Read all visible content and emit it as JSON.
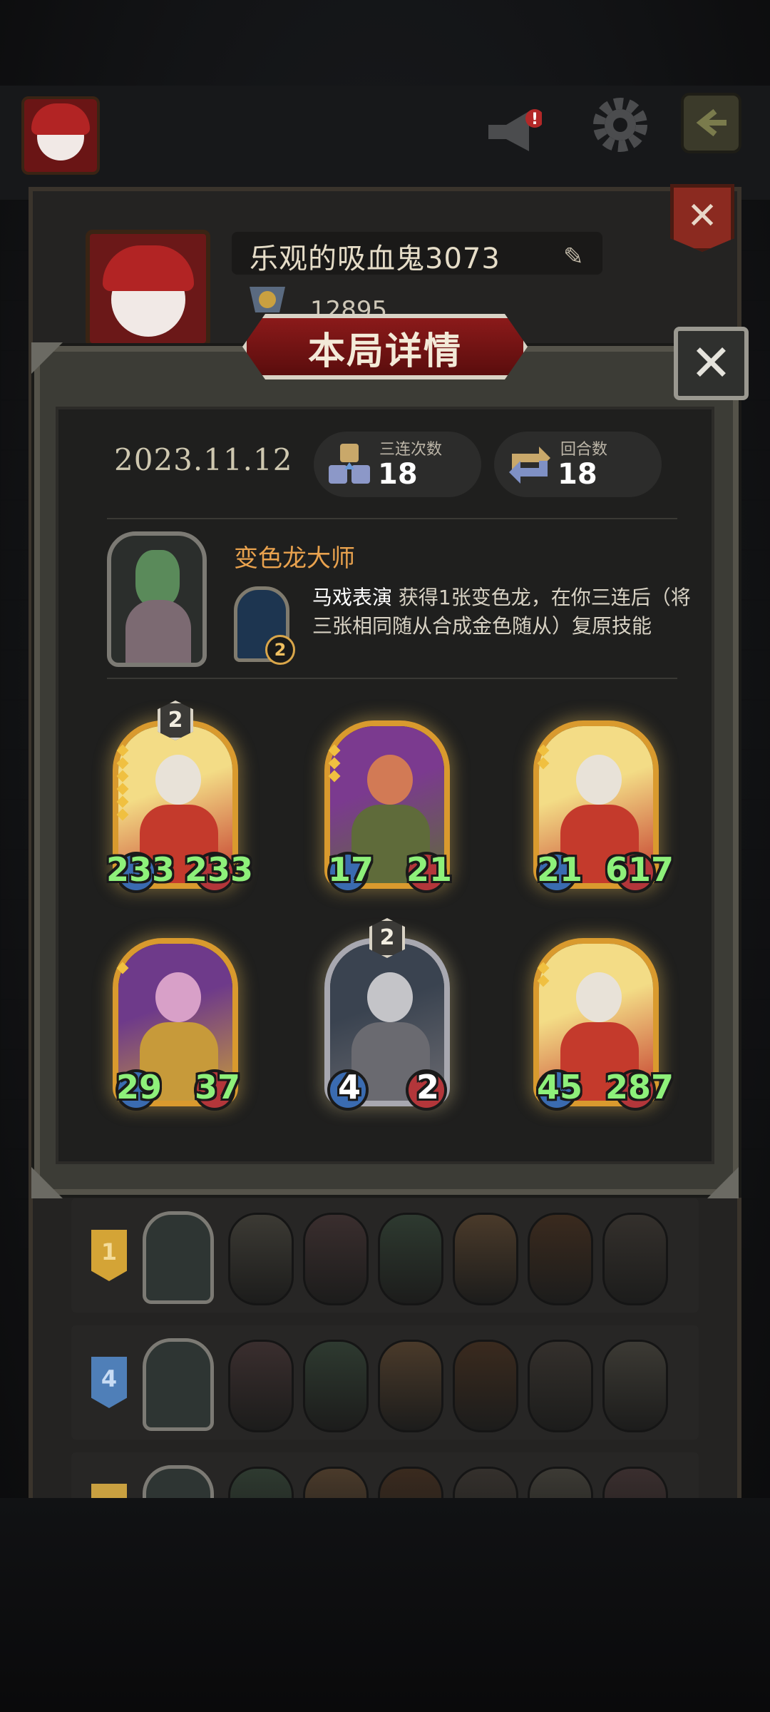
{
  "profile": {
    "player_name": "乐观的吸血鬼3073",
    "trophy_count": "12895"
  },
  "modal": {
    "title": "本局详情",
    "date": "2023.11.12",
    "triples": {
      "label": "三连次数",
      "value": "18"
    },
    "turns": {
      "label": "回合数",
      "value": "18"
    },
    "hero": {
      "name": "变色龙大师",
      "skill_level": "2",
      "skill_name": "马戏表演",
      "skill_desc": "获得1张变色龙，在你三连后（将三张相同随从合成金色随从）复原技能"
    },
    "cards": [
      {
        "tier": "2",
        "attack": "233",
        "health": "233",
        "frame": "gold",
        "art": "dwarf-warrior",
        "pips": 6
      },
      {
        "tier": "",
        "attack": "17",
        "health": "21",
        "frame": "gold",
        "art": "red-haired-brute",
        "pips": 3
      },
      {
        "tier": "",
        "attack": "21",
        "health": "617",
        "frame": "gold",
        "art": "dwarf-warrior",
        "pips": 2
      },
      {
        "tier": "",
        "attack": "29",
        "health": "37",
        "frame": "gold",
        "art": "witch",
        "pips": 1
      },
      {
        "tier": "2",
        "attack": "4",
        "health": "2",
        "frame": "silver",
        "art": "armored-knight",
        "pips": 0
      },
      {
        "tier": "",
        "attack": "45",
        "health": "287",
        "frame": "gold",
        "art": "dwarf-warrior",
        "pips": 2
      }
    ]
  },
  "history": [
    {
      "rank": "1",
      "rank_color": "#d4a436"
    },
    {
      "rank": "4",
      "rank_color": "#4f7fb8"
    },
    {
      "rank": "",
      "rank_color": "#c9a040"
    }
  ],
  "colors": {
    "accent_gold": "#d99a2e",
    "hero_name": "#e9a24e",
    "stat_green": "#8ef07a",
    "banner_red": "#8b1a1a"
  }
}
